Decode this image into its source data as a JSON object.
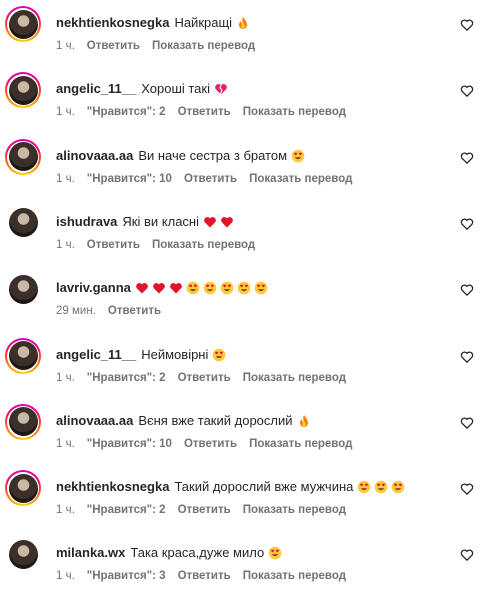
{
  "meta_labels": {
    "reply": "Ответить",
    "show_translation": "Показать перевод"
  },
  "comments": [
    {
      "username": "nekhtienkosnegka",
      "text": "Найкращі",
      "emojis": [
        "fire"
      ],
      "time": "1 ч.",
      "likes": "",
      "ring": true
    },
    {
      "username": "angelic_11__",
      "text": "Хороші такі",
      "emojis": [
        "broken-heart"
      ],
      "time": "1 ч.",
      "likes": "\"Нравится\": 2",
      "ring": true
    },
    {
      "username": "alinovaaa.aa",
      "text": "Ви наче сестра з братом",
      "emojis": [
        "heart-eyes"
      ],
      "time": "1 ч.",
      "likes": "\"Нравится\": 10",
      "ring": true
    },
    {
      "username": "ishudrava",
      "text": "Які ви класні",
      "emojis": [
        "red-heart",
        "red-heart"
      ],
      "time": "1 ч.",
      "likes": "",
      "ring": false
    },
    {
      "username": "lavriv.ganna",
      "text": "",
      "emojis": [
        "red-heart",
        "red-heart",
        "red-heart",
        "heart-eyes",
        "heart-eyes",
        "heart-eyes",
        "heart-eyes",
        "heart-eyes"
      ],
      "time": "29 мин.",
      "likes": "",
      "ring": false,
      "no_translation": true
    },
    {
      "username": "angelic_11__",
      "text": "Неймовірні",
      "emojis": [
        "heart-eyes"
      ],
      "time": "1 ч.",
      "likes": "\"Нравится\": 2",
      "ring": true
    },
    {
      "username": "alinovaaa.aa",
      "text": "Вєня вже такий дорослий",
      "emojis": [
        "fire"
      ],
      "time": "1 ч.",
      "likes": "\"Нравится\": 10",
      "ring": true
    },
    {
      "username": "nekhtienkosnegka",
      "text": "Такий дорослий вже мужчина",
      "emojis": [
        "heart-eyes",
        "heart-eyes",
        "heart-eyes"
      ],
      "time": "1 ч.",
      "likes": "\"Нравится\": 2",
      "ring": true
    },
    {
      "username": "milanka.wx",
      "text": "Така краса,дуже мило",
      "emojis": [
        "heart-eyes"
      ],
      "time": "1 ч.",
      "likes": "\"Нравится\": 3",
      "ring": false
    }
  ]
}
